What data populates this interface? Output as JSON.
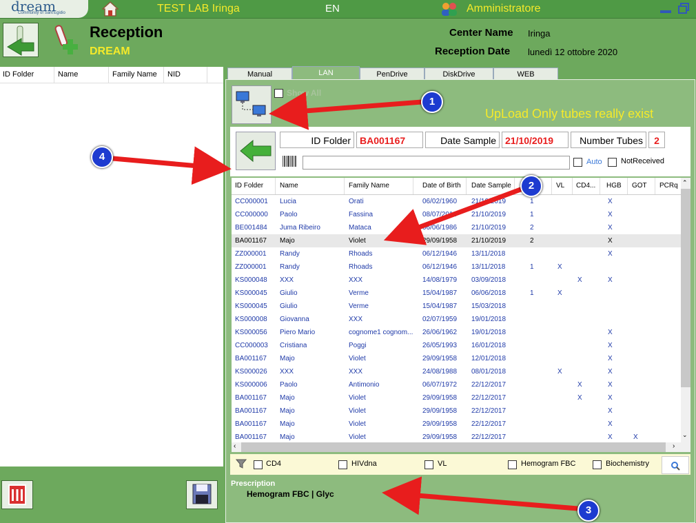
{
  "topbar": {
    "logo_text": "dream",
    "logo_sub": "Community of Sant'Egidio",
    "home_icon": "home-icon",
    "lab_name": "TEST LAB Iringa",
    "language": "EN",
    "user": "Amministratore",
    "user_icon": "users-icon"
  },
  "header": {
    "title": "Reception",
    "subtitle": "DREAM",
    "center_name_label": "Center Name",
    "center_name_value": "Iringa",
    "reception_date_label": "Reception Date",
    "reception_date_value": "lunedì 12 ottobre 2020"
  },
  "left_table": {
    "columns": [
      "ID Folder",
      "Name",
      "Family Name",
      "NID"
    ]
  },
  "tabs": [
    "Manual",
    "LAN",
    "PenDrive",
    "DiskDrive",
    "WEB"
  ],
  "active_tab": "LAN",
  "lan": {
    "show_all_label": "Show All",
    "upload_notice": "UpLoad Only tubes really exist",
    "id_folder_label": "ID Folder",
    "id_folder_value": "BA001167",
    "date_sample_label": "Date Sample",
    "date_sample_value": "21/10/2019",
    "number_tubes_label": "Number Tubes",
    "number_tubes_value": "2",
    "auto_label": "Auto",
    "not_received_label": "NotReceived"
  },
  "table": {
    "columns": [
      "ID Folder",
      "Name",
      "Family Name",
      "Date of Birth",
      "Date Sample",
      "B",
      "VL",
      "CD4...",
      "HGB",
      "GOT",
      "PCRq"
    ],
    "rows": [
      [
        "CC000001",
        "Lucia",
        "Orati",
        "06/02/1960",
        "21/10/2019",
        "1",
        "",
        "",
        "X",
        "",
        ""
      ],
      [
        "CC000000",
        "Paolo",
        "Fassina",
        "08/07/2011",
        "21/10/2019",
        "1",
        "",
        "",
        "X",
        "",
        ""
      ],
      [
        "BE001484",
        "Juma  Ribeiro",
        "Mataca",
        "06/06/1986",
        "21/10/2019",
        "2",
        "",
        "",
        "X",
        "",
        ""
      ],
      [
        "BA001167",
        "Majo",
        "Violet",
        "29/09/1958",
        "21/10/2019",
        "2",
        "",
        "",
        "X",
        "",
        ""
      ],
      [
        "ZZ000001",
        "Randy",
        "Rhoads",
        "06/12/1946",
        "13/11/2018",
        "",
        "",
        "",
        "X",
        "",
        ""
      ],
      [
        "ZZ000001",
        "Randy",
        "Rhoads",
        "06/12/1946",
        "13/11/2018",
        "1",
        "X",
        "",
        "",
        "",
        ""
      ],
      [
        "KS000048",
        "XXX",
        "XXX",
        "14/08/1979",
        "03/09/2018",
        "",
        "",
        "X",
        "X",
        "",
        ""
      ],
      [
        "KS000045",
        "Giulio",
        "Verme",
        "15/04/1987",
        "06/06/2018",
        "1",
        "X",
        "",
        "",
        "",
        ""
      ],
      [
        "KS000045",
        "Giulio",
        "Verme",
        "15/04/1987",
        "15/03/2018",
        "",
        "",
        "",
        "",
        "",
        ""
      ],
      [
        "KS000008",
        "Giovanna",
        "XXX",
        "02/07/1959",
        "19/01/2018",
        "",
        "",
        "",
        "",
        "",
        ""
      ],
      [
        "KS000056",
        "Piero Mario",
        "cognome1 cognom...",
        "26/06/1962",
        "19/01/2018",
        "",
        "",
        "",
        "X",
        "",
        ""
      ],
      [
        "CC000003",
        "Cristiana",
        "Poggi",
        "26/05/1993",
        "16/01/2018",
        "",
        "",
        "",
        "X",
        "",
        ""
      ],
      [
        "BA001167",
        "Majo",
        "Violet",
        "29/09/1958",
        "12/01/2018",
        "",
        "",
        "",
        "X",
        "",
        ""
      ],
      [
        "KS000026",
        "XXX",
        "XXX",
        "24/08/1988",
        "08/01/2018",
        "",
        "X",
        "",
        "X",
        "",
        ""
      ],
      [
        "KS000006",
        "Paolo",
        "Antimonio",
        "06/07/1972",
        "22/12/2017",
        "",
        "",
        "X",
        "X",
        "",
        ""
      ],
      [
        "BA001167",
        "Majo",
        "Violet",
        "29/09/1958",
        "22/12/2017",
        "",
        "",
        "X",
        "X",
        "",
        ""
      ],
      [
        "BA001167",
        "Majo",
        "Violet",
        "29/09/1958",
        "22/12/2017",
        "",
        "",
        "",
        "X",
        "",
        ""
      ],
      [
        "BA001167",
        "Majo",
        "Violet",
        "29/09/1958",
        "22/12/2017",
        "",
        "",
        "",
        "X",
        "",
        ""
      ],
      [
        "BA001167",
        "Majo",
        "Violet",
        "29/09/1958",
        "22/12/2017",
        "",
        "",
        "",
        "X",
        "X",
        ""
      ]
    ],
    "selected_row": 3
  },
  "filters": [
    "CD4",
    "HIVdna",
    "VL",
    "Hemogram FBC",
    "Biochemistry"
  ],
  "prescription": {
    "label": "Prescription",
    "value": "Hemogram FBC | Glyc"
  },
  "annotations": [
    "1",
    "2",
    "3",
    "4"
  ],
  "colors": {
    "accent_yellow": "#f5ea2a",
    "panel_green": "#8dbb7e",
    "badge_blue": "#1d3bd0",
    "arrow_red": "#e81d1d"
  }
}
